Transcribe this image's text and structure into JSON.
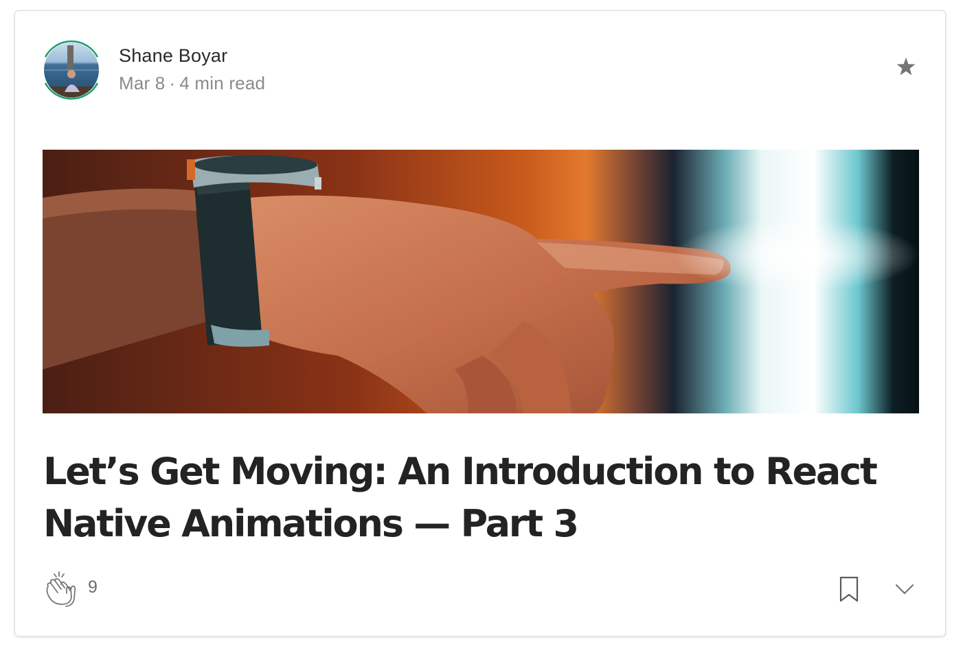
{
  "author": {
    "name": "Shane Boyar",
    "date": "Mar 8",
    "separator": "·",
    "read_time": "4 min read"
  },
  "icons": {
    "star": "star-icon",
    "clap": "clap-icon",
    "bookmark": "bookmark-icon",
    "more": "chevron-down-icon"
  },
  "post": {
    "title": "Let’s Get Moving: An Introduction to React Native Animations — Part 3"
  },
  "stats": {
    "claps": "9"
  },
  "colors": {
    "accent_ring": "#1b9e6a",
    "text_primary": "#292929",
    "text_secondary": "#8a8a8a",
    "icon_gray": "#757575"
  }
}
